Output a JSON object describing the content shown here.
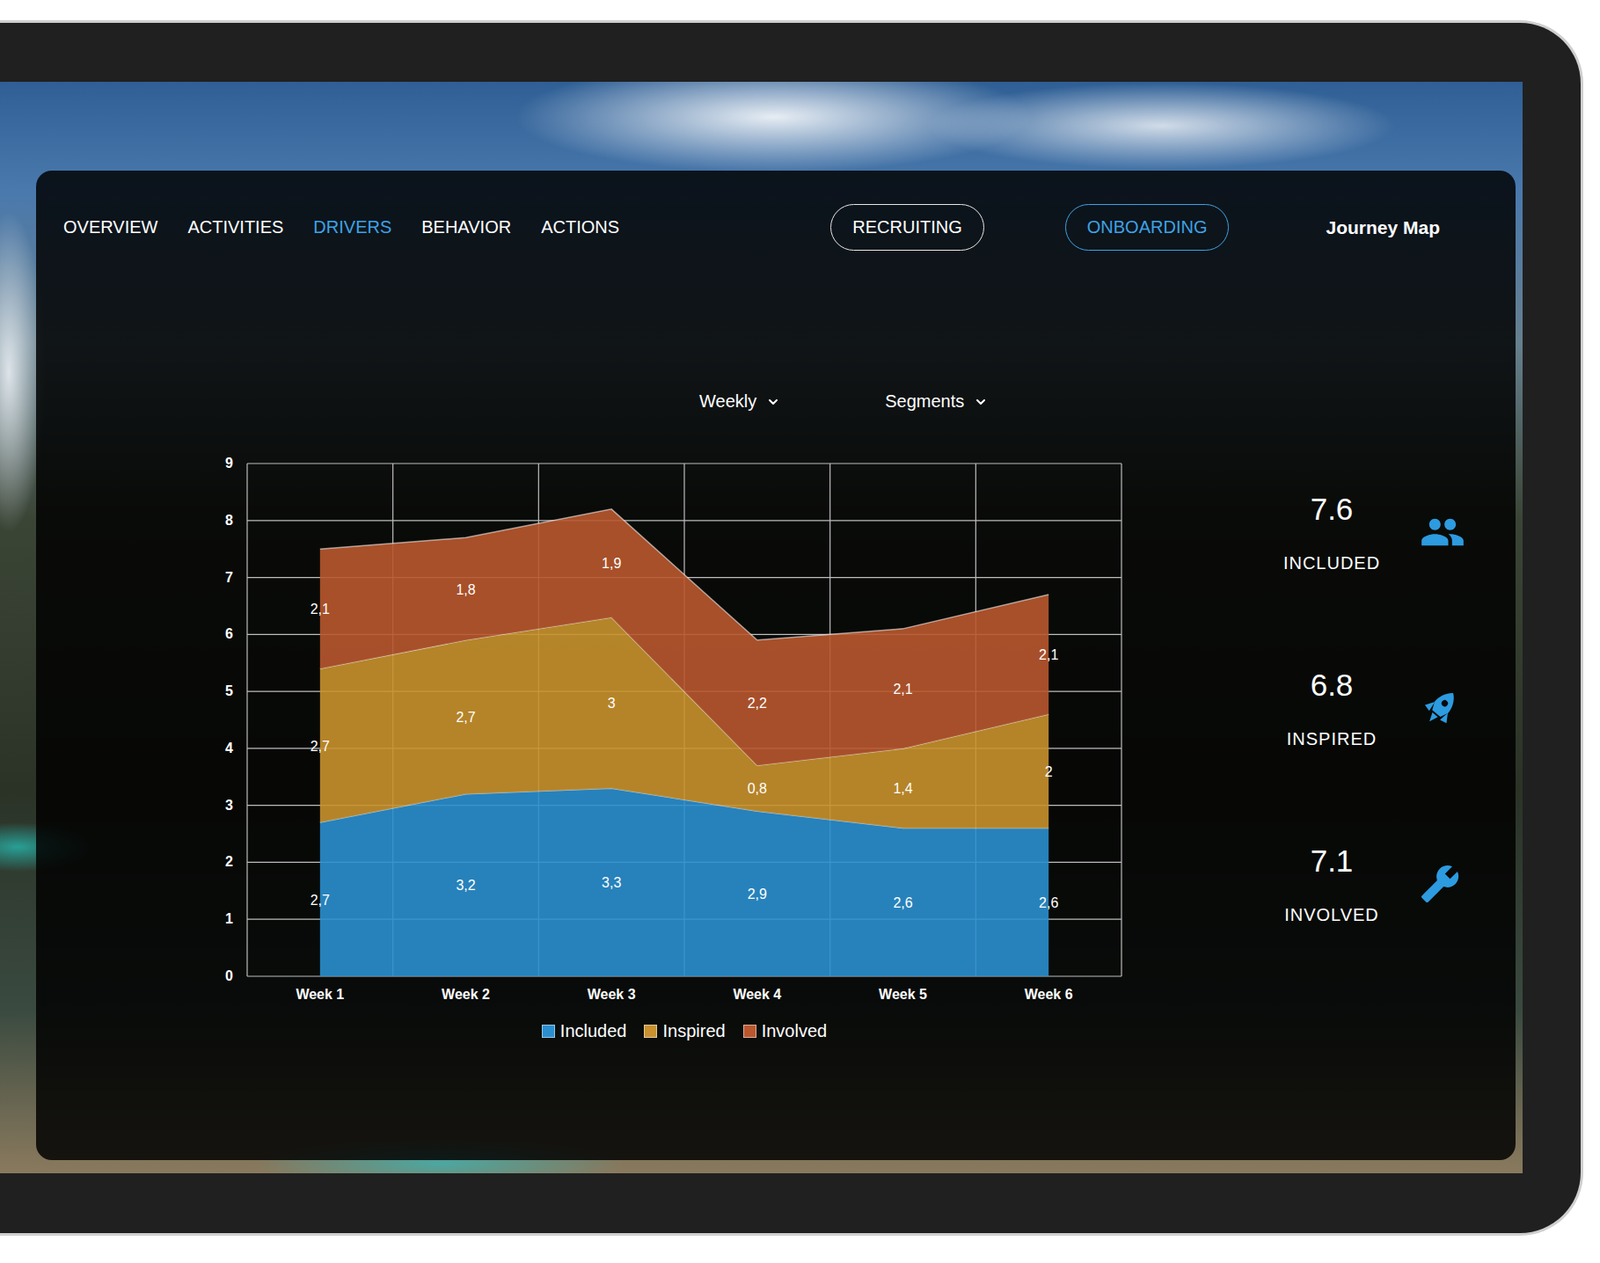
{
  "nav": {
    "tabs": [
      {
        "label": "OVERVIEW",
        "selected": false
      },
      {
        "label": "ACTIVITIES",
        "selected": false
      },
      {
        "label": "DRIVERS",
        "selected": true
      },
      {
        "label": "BEHAVIOR",
        "selected": false
      },
      {
        "label": "ACTIONS",
        "selected": false
      }
    ],
    "journeys": [
      {
        "label": "RECRUITING",
        "selected": false
      },
      {
        "label": "ONBOARDING",
        "selected": true
      }
    ],
    "link": "Journey Map"
  },
  "filters": [
    {
      "label": "Weekly"
    },
    {
      "label": "Segments"
    }
  ],
  "chart": {
    "y_ticks": [
      "0",
      "1",
      "2",
      "3",
      "4",
      "5",
      "6",
      "7",
      "8",
      "9"
    ],
    "categories": [
      "Week 1",
      "Week 2",
      "Week 3",
      "Week 4",
      "Week 5",
      "Week 6"
    ],
    "series": [
      {
        "name": "Included",
        "color": "#2b8fcf",
        "values": [
          2.7,
          3.2,
          3.3,
          2.9,
          2.6,
          2.6
        ],
        "labels": [
          "2,7",
          "3,2",
          "3,3",
          "2,9",
          "2,6",
          "2,6"
        ]
      },
      {
        "name": "Inspired",
        "color": "#c9922e",
        "values": [
          2.7,
          2.7,
          3,
          0.8,
          1.4,
          2
        ],
        "labels": [
          "2,7",
          "2,7",
          "3",
          "0,8",
          "1,4",
          "2"
        ]
      },
      {
        "name": "Involved",
        "color": "#b9582f",
        "values": [
          2.1,
          1.8,
          1.9,
          2.2,
          2.1,
          2.1
        ],
        "labels": [
          "2,1",
          "1,8",
          "1,9",
          "2,2",
          "2,1",
          "2,1"
        ]
      }
    ]
  },
  "stats": [
    {
      "value": "7.6",
      "label": "INCLUDED"
    },
    {
      "value": "6.8",
      "label": "INSPIRED"
    },
    {
      "value": "7.1",
      "label": "INVOLVED"
    }
  ]
}
